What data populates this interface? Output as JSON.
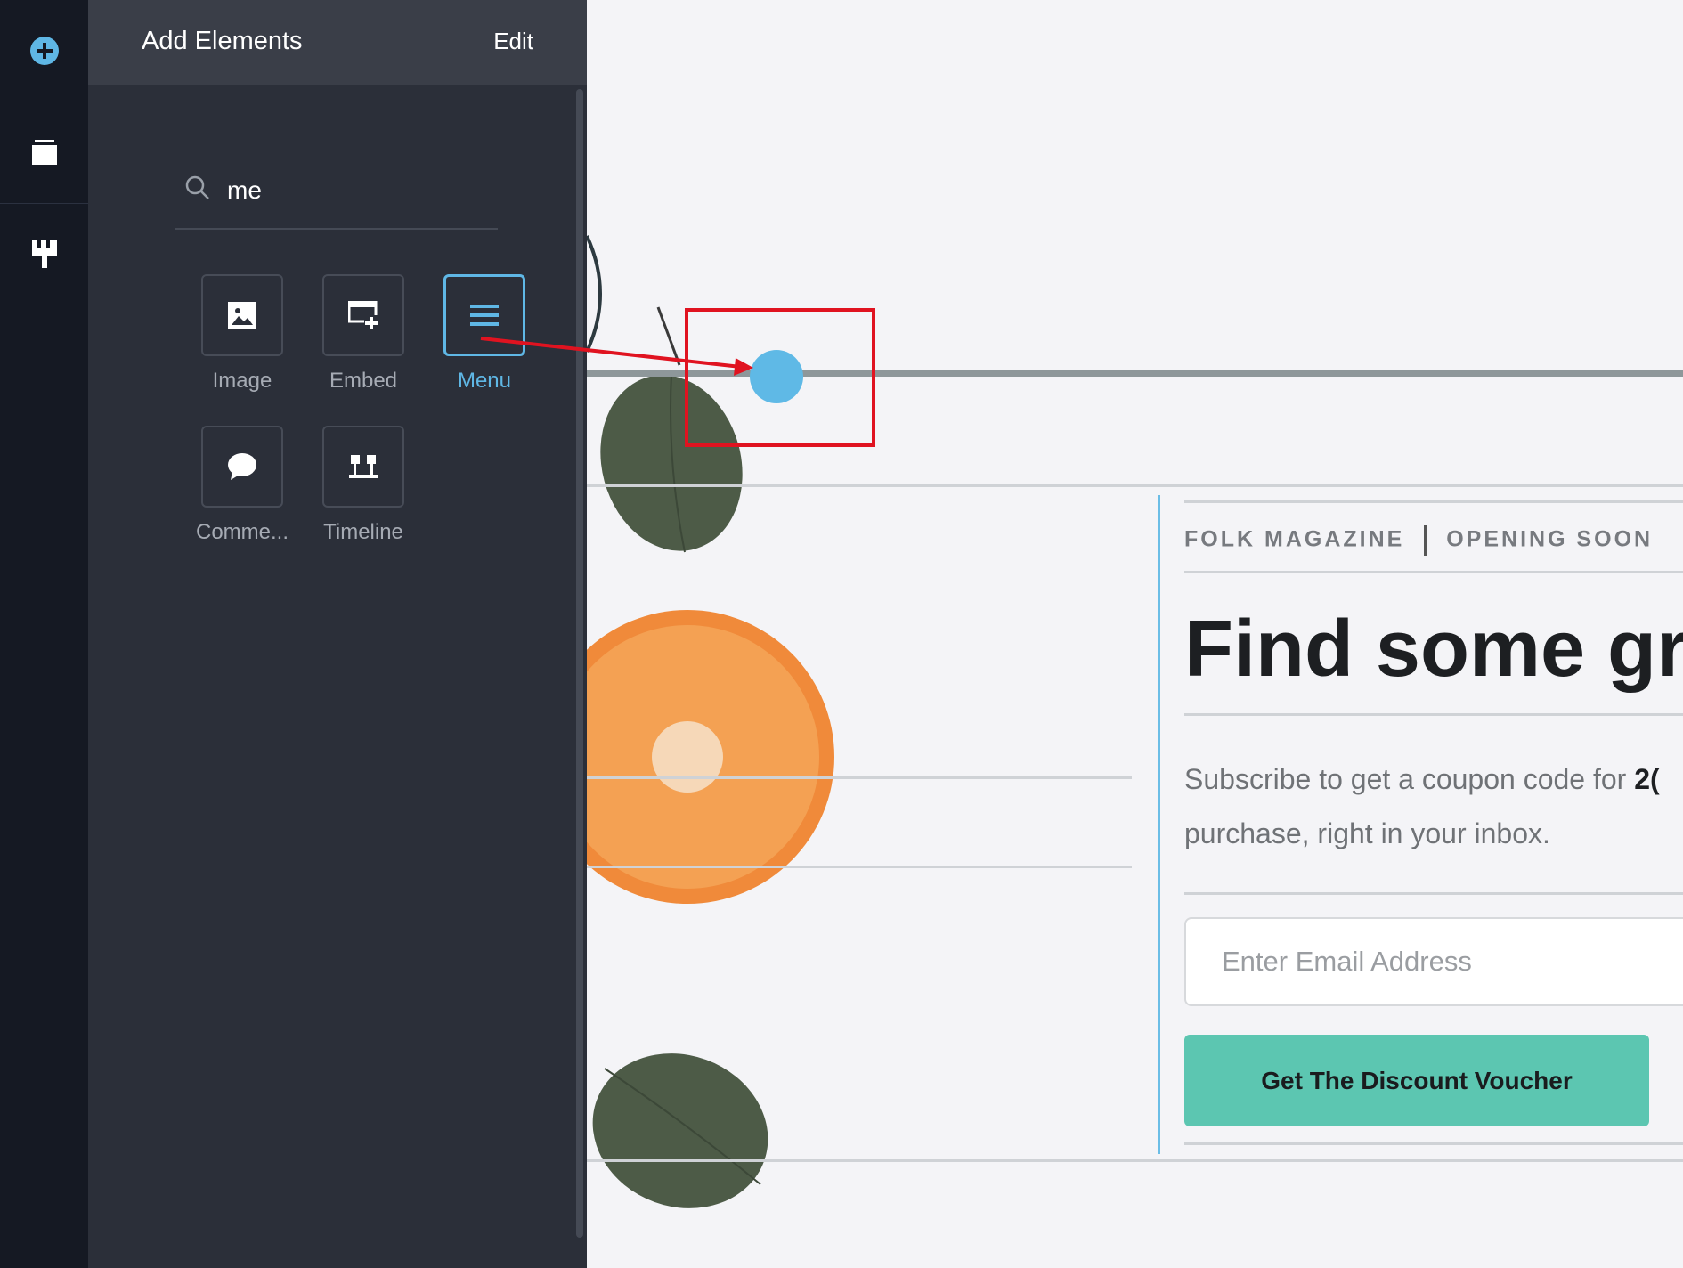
{
  "rail": {
    "items": [
      {
        "name": "add-element-icon"
      },
      {
        "name": "pages-icon"
      },
      {
        "name": "design-brush-icon"
      }
    ]
  },
  "panel": {
    "title": "Add Elements",
    "edit_label": "Edit",
    "search": {
      "value": "me",
      "icon": "search-icon"
    },
    "tiles": [
      {
        "label": "Image",
        "icon": "image-icon",
        "active": false
      },
      {
        "label": "Embed",
        "icon": "embed-icon",
        "active": false
      },
      {
        "label": "Menu",
        "icon": "menu-icon",
        "active": true
      },
      {
        "label": "Comme...",
        "icon": "comment-icon",
        "active": false
      },
      {
        "label": "Timeline",
        "icon": "timeline-icon",
        "active": false
      }
    ]
  },
  "canvas": {
    "overline_left": "FOLK MAGAZINE",
    "overline_right": "OPENING SOON",
    "headline": "Find some gre",
    "subtext_before": "Subscribe to get a coupon code for ",
    "subtext_bold": "2(",
    "subtext_after": "purchase, right in your inbox.",
    "email_placeholder": "Enter Email Address",
    "cta_label": "Get The Discount Voucher"
  },
  "colors": {
    "accent": "#5fb7e5",
    "cta": "#5cc6b1",
    "highlight": "#e01320",
    "panel_bg": "#2b2f39",
    "rail_bg": "#151923"
  }
}
